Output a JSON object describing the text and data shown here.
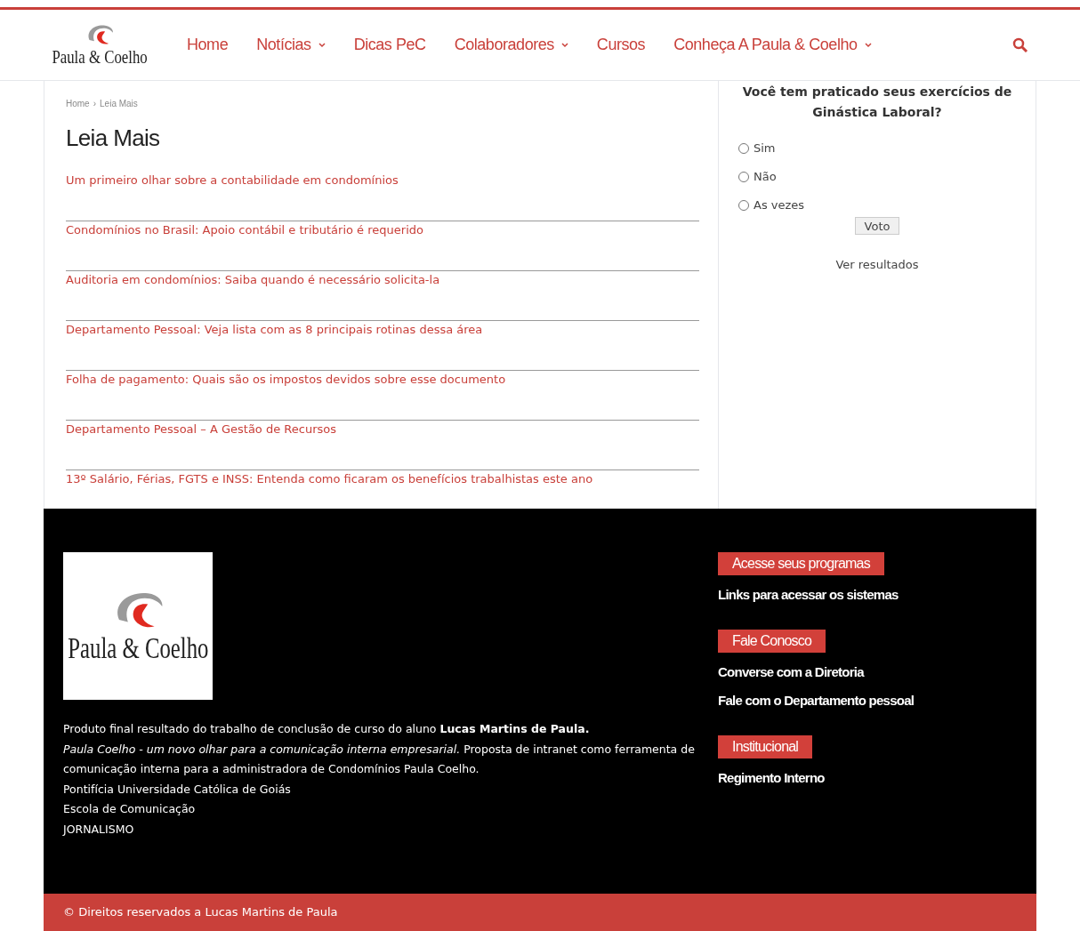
{
  "header": {
    "logo": "Paula & Coelho",
    "nav": [
      {
        "label": "Home",
        "dropdown": false
      },
      {
        "label": "Notícias",
        "dropdown": true
      },
      {
        "label": "Dicas PeC",
        "dropdown": false
      },
      {
        "label": "Colaboradores",
        "dropdown": true
      },
      {
        "label": "Cursos",
        "dropdown": false
      },
      {
        "label": "Conheça A Paula & Coelho",
        "dropdown": true
      }
    ]
  },
  "breadcrumb": {
    "items": [
      "Home",
      "Leia Mais"
    ],
    "separator": "›"
  },
  "page_title": "Leia Mais",
  "articles": [
    "Um primeiro olhar sobre a contabilidade em condomínios",
    "Condomínios no Brasil: Apoio contábil e tributário é requerido",
    "Auditoria em condomínios: Saiba quando é necessário solicita-la",
    "Departamento Pessoal: Veja lista com as 8 principais rotinas dessa área",
    "Folha de pagamento: Quais são os impostos devidos sobre esse documento",
    "Departamento Pessoal – A Gestão de Recursos",
    "13º Salário, Férias, FGTS e INSS: Entenda como ficaram os benefícios trabalhistas este ano"
  ],
  "poll": {
    "question": "Você tem praticado seus exercícios de Ginástica Laboral?",
    "options": [
      {
        "label": "Sim",
        "selected": false
      },
      {
        "label": "Não",
        "selected": false
      },
      {
        "label": "As vezes",
        "selected": false
      }
    ],
    "button": "Voto",
    "results_link": "Ver resultados"
  },
  "footer": {
    "logo": "Paula & Coelho",
    "about": [
      "Produto final resultado do trabalho de conclusão de curso do aluno **Lucas Martins de Paula.**",
      "*Paula Coelho - um novo olhar para a comunicação interna empresarial.* Proposta de intranet como ferramenta de comunicação interna para a administradora de Condomínios Paula Coelho.",
      "Pontifícia Universidade Católica de Goiás",
      "Escola de Comunicação",
      "JORNALISMO"
    ],
    "sections": [
      {
        "heading": "Acesse seus programas",
        "links": [
          "Links para acessar os sistemas"
        ]
      },
      {
        "heading": "Fale Conosco",
        "links": [
          "Converse com a Diretoria",
          "Fale com o Departamento pessoal"
        ]
      },
      {
        "heading": "Institucional",
        "links": [
          "Regimento Interno"
        ]
      }
    ],
    "copyright": "© Direitos reservados a Lucas Martins de Paula"
  }
}
